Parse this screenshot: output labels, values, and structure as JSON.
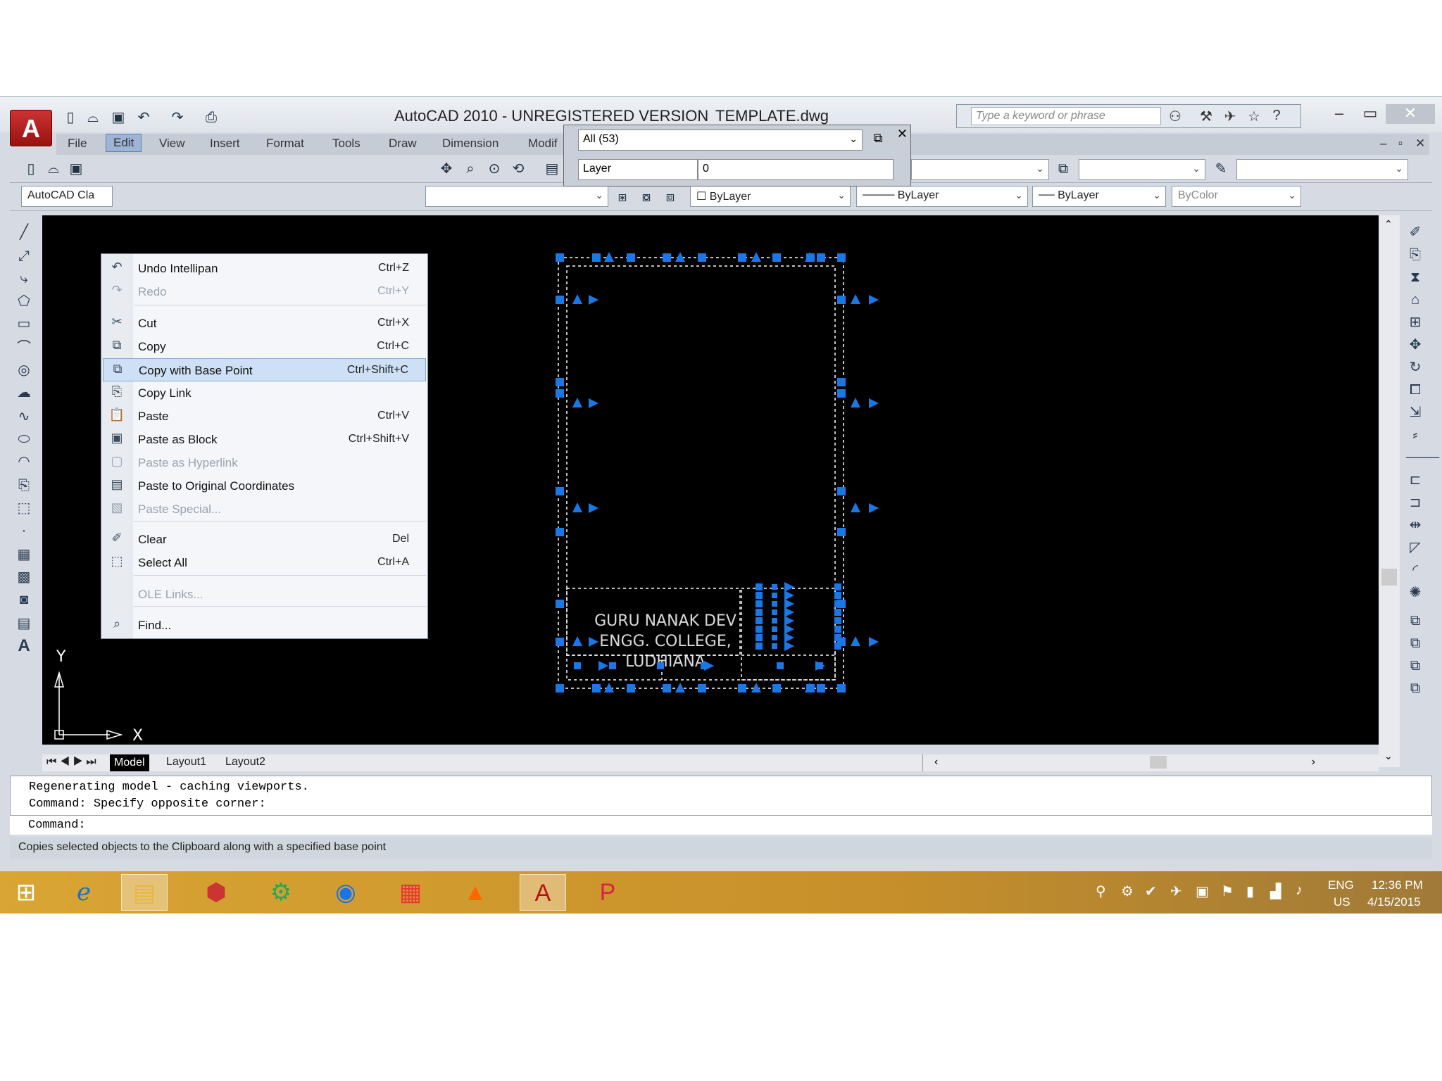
{
  "window": {
    "title": "AutoCAD 2010 - UNREGISTERED VERSION",
    "file": "TEMPLATE.dwg",
    "app_logo": "A",
    "help_search_placeholder": "Type a keyword or phrase"
  },
  "menubar": [
    "File",
    "Edit",
    "View",
    "Insert",
    "Format",
    "Tools",
    "Draw",
    "Dimension",
    "Modif"
  ],
  "workspace_combo": "AutoCAD Cla",
  "layer_panel": {
    "filter": "All (53)",
    "layer_label": "Layer",
    "layer_value": "0"
  },
  "properties": {
    "color": "ByLayer",
    "linetype": "ByLayer",
    "lineweight": "ByLayer",
    "plotstyle": "ByColor"
  },
  "edit_menu": [
    {
      "label": "Undo Intellipan",
      "shortcut": "Ctrl+Z",
      "icon": "undo-icon"
    },
    {
      "label": "Redo",
      "shortcut": "Ctrl+Y",
      "icon": "redo-icon"
    },
    {
      "label": "Cut",
      "shortcut": "Ctrl+X",
      "icon": "scissors-icon"
    },
    {
      "label": "Copy",
      "shortcut": "Ctrl+C",
      "icon": "copy-icon"
    },
    {
      "label": "Copy with Base Point",
      "shortcut": "Ctrl+Shift+C",
      "icon": "copy-base-icon"
    },
    {
      "label": "Copy Link",
      "shortcut": "",
      "icon": "copy-link-icon"
    },
    {
      "label": "Paste",
      "shortcut": "Ctrl+V",
      "icon": "paste-icon"
    },
    {
      "label": "Paste as Block",
      "shortcut": "Ctrl+Shift+V",
      "icon": "paste-block-icon"
    },
    {
      "label": "Paste as Hyperlink",
      "shortcut": "",
      "icon": "paste-hyperlink-icon"
    },
    {
      "label": "Paste to Original Coordinates",
      "shortcut": "",
      "icon": "paste-coords-icon"
    },
    {
      "label": "Paste Special...",
      "shortcut": "",
      "icon": "paste-special-icon"
    },
    {
      "label": "Clear",
      "shortcut": "Del",
      "icon": "eraser-icon"
    },
    {
      "label": "Select All",
      "shortcut": "Ctrl+A",
      "icon": "select-all-icon"
    },
    {
      "label": "OLE Links...",
      "shortcut": "",
      "icon": ""
    },
    {
      "label": "Find...",
      "shortcut": "",
      "icon": "find-icon"
    }
  ],
  "drawing_text": [
    "GURU NANAK DEV",
    "ENGG. COLLEGE,",
    "LUDHIANA"
  ],
  "ucs": {
    "x": "X",
    "y": "Y"
  },
  "tabs": [
    "Model",
    "Layout1",
    "Layout2"
  ],
  "command_history": [
    "Regenerating model - caching viewports.",
    "Command: Specify opposite corner:"
  ],
  "command_prompt": "Command:",
  "status_text": "Copies selected objects to the Clipboard along with a specified base point",
  "taskbar": {
    "lang1": "ENG",
    "lang2": "US",
    "time": "12:36 PM",
    "date": "4/15/2015"
  },
  "colors": {
    "grip": "#1a78e6",
    "canvas": "#000000",
    "highlight": "#cde0f5"
  }
}
